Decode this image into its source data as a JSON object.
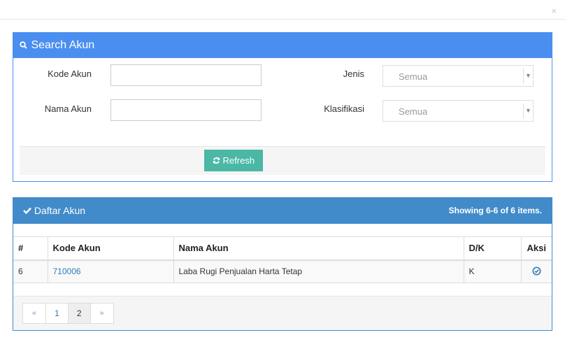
{
  "modal": {
    "close_label": "×"
  },
  "search": {
    "title": "Search Akun",
    "fields": {
      "kode_akun": {
        "label": "Kode Akun",
        "value": ""
      },
      "nama_akun": {
        "label": "Nama Akun",
        "value": ""
      },
      "jenis": {
        "label": "Jenis",
        "value": "Semua"
      },
      "klasifikasi": {
        "label": "Klasifikasi",
        "value": "Semua"
      }
    },
    "refresh_label": "Refresh"
  },
  "list": {
    "title": "Daftar Akun",
    "summary": "Showing 6-6 of 6 items.",
    "columns": [
      "#",
      "Kode Akun",
      "Nama Akun",
      "D/K",
      "Aksi"
    ],
    "rows": [
      {
        "no": "6",
        "kode": "710006",
        "nama": "Laba Rugi Penjualan Harta Tetap",
        "dk": "K"
      }
    ],
    "pagination": {
      "prev": "«",
      "pages": [
        "1",
        "2"
      ],
      "active": "2",
      "next": "»"
    }
  },
  "colors": {
    "search_header": "#4a8ef0",
    "list_header": "#428bca",
    "refresh_button": "#4bb7a5",
    "link": "#337ab7"
  },
  "icons": {
    "search_title": "search-icon",
    "refresh": "refresh-icon",
    "list_title": "check-icon",
    "row_action": "check-circle-icon"
  }
}
